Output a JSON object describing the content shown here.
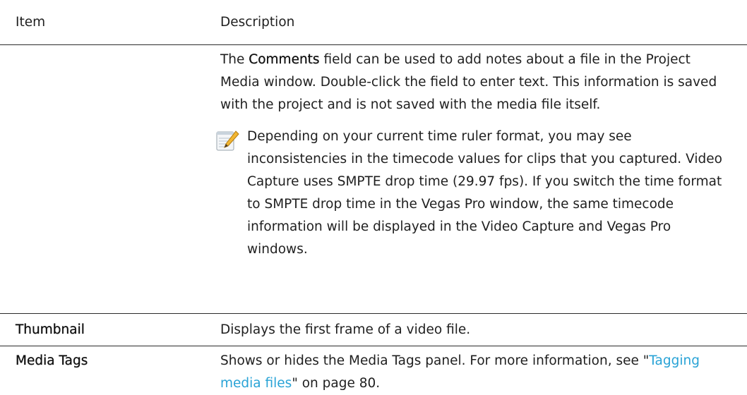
{
  "table": {
    "header": {
      "item": "Item",
      "description": "Description"
    },
    "comments_row": {
      "item": "",
      "text_before": "The ",
      "bold_term": "Comments",
      "text_after": " field can be used to add notes about a file in the Project Media window. Double-click the field to enter text. This information is saved with the project and is not saved with the media file itself.",
      "note_icon": "note-pencil-icon",
      "note_text": "Depending on your current time ruler format, you may see inconsistencies in the timecode values for clips that you captured. Video Capture uses SMPTE drop time (29.97 fps). If you switch the time format to SMPTE drop time in the Vegas Pro window, the same timecode information will be displayed in the Video Capture and Vegas Pro windows."
    },
    "thumbnail_row": {
      "item": "Thumbnail",
      "description": "Displays the first frame of a video file."
    },
    "media_tags_row": {
      "item": "Media Tags",
      "text_before": "Shows or hides the Media Tags panel. For more information, see \"",
      "link_text": "Tagging media files",
      "text_after": "\" on page 80."
    }
  },
  "colors": {
    "link": "#29a3d6",
    "border": "#2a2a2a",
    "text": "#1f1f1f"
  }
}
